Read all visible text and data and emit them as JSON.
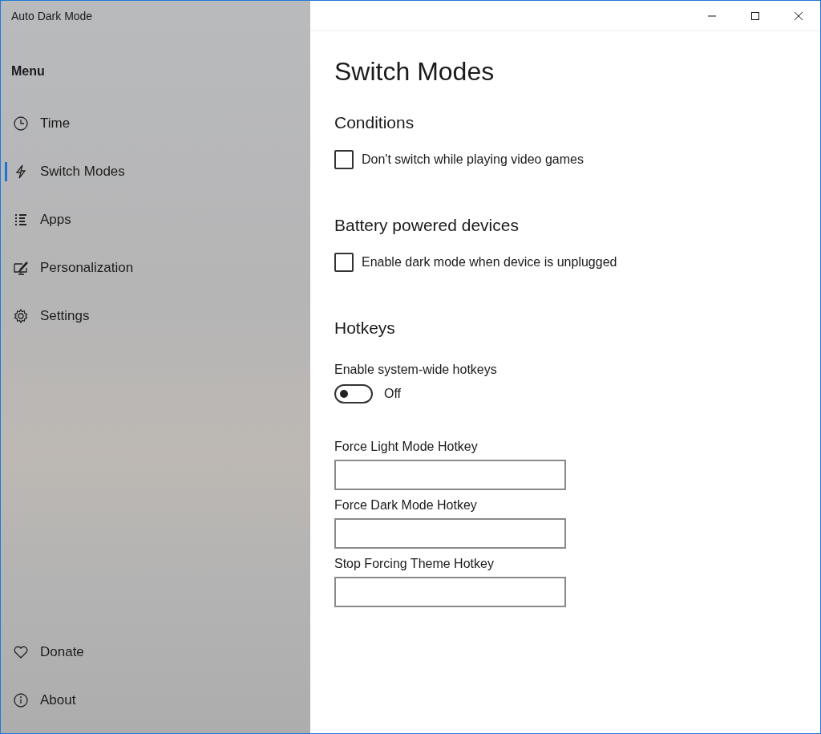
{
  "window": {
    "title": "Auto Dark Mode"
  },
  "sidebar": {
    "heading": "Menu",
    "items": [
      {
        "label": "Time",
        "selected": false
      },
      {
        "label": "Switch Modes",
        "selected": true
      },
      {
        "label": "Apps",
        "selected": false
      },
      {
        "label": "Personalization",
        "selected": false
      },
      {
        "label": "Settings",
        "selected": false
      }
    ],
    "footer_items": [
      {
        "label": "Donate"
      },
      {
        "label": "About"
      }
    ]
  },
  "page": {
    "title": "Switch Modes",
    "sections": [
      {
        "heading": "Conditions",
        "items": [
          {
            "kind": "checkbox",
            "label": "Don't switch while playing video games",
            "checked": false
          }
        ]
      },
      {
        "heading": "Battery powered devices",
        "items": [
          {
            "kind": "checkbox",
            "label": "Enable dark mode when device is unplugged",
            "checked": false
          }
        ]
      },
      {
        "heading": "Hotkeys",
        "items": [
          {
            "kind": "toggle",
            "label": "Enable system-wide hotkeys",
            "on": false,
            "state_text": "Off"
          },
          {
            "kind": "field",
            "label": "Force Light Mode Hotkey"
          },
          {
            "kind": "field",
            "label": "Force Dark Mode Hotkey"
          },
          {
            "kind": "field",
            "label": "Stop Forcing Theme Hotkey"
          }
        ]
      }
    ]
  }
}
